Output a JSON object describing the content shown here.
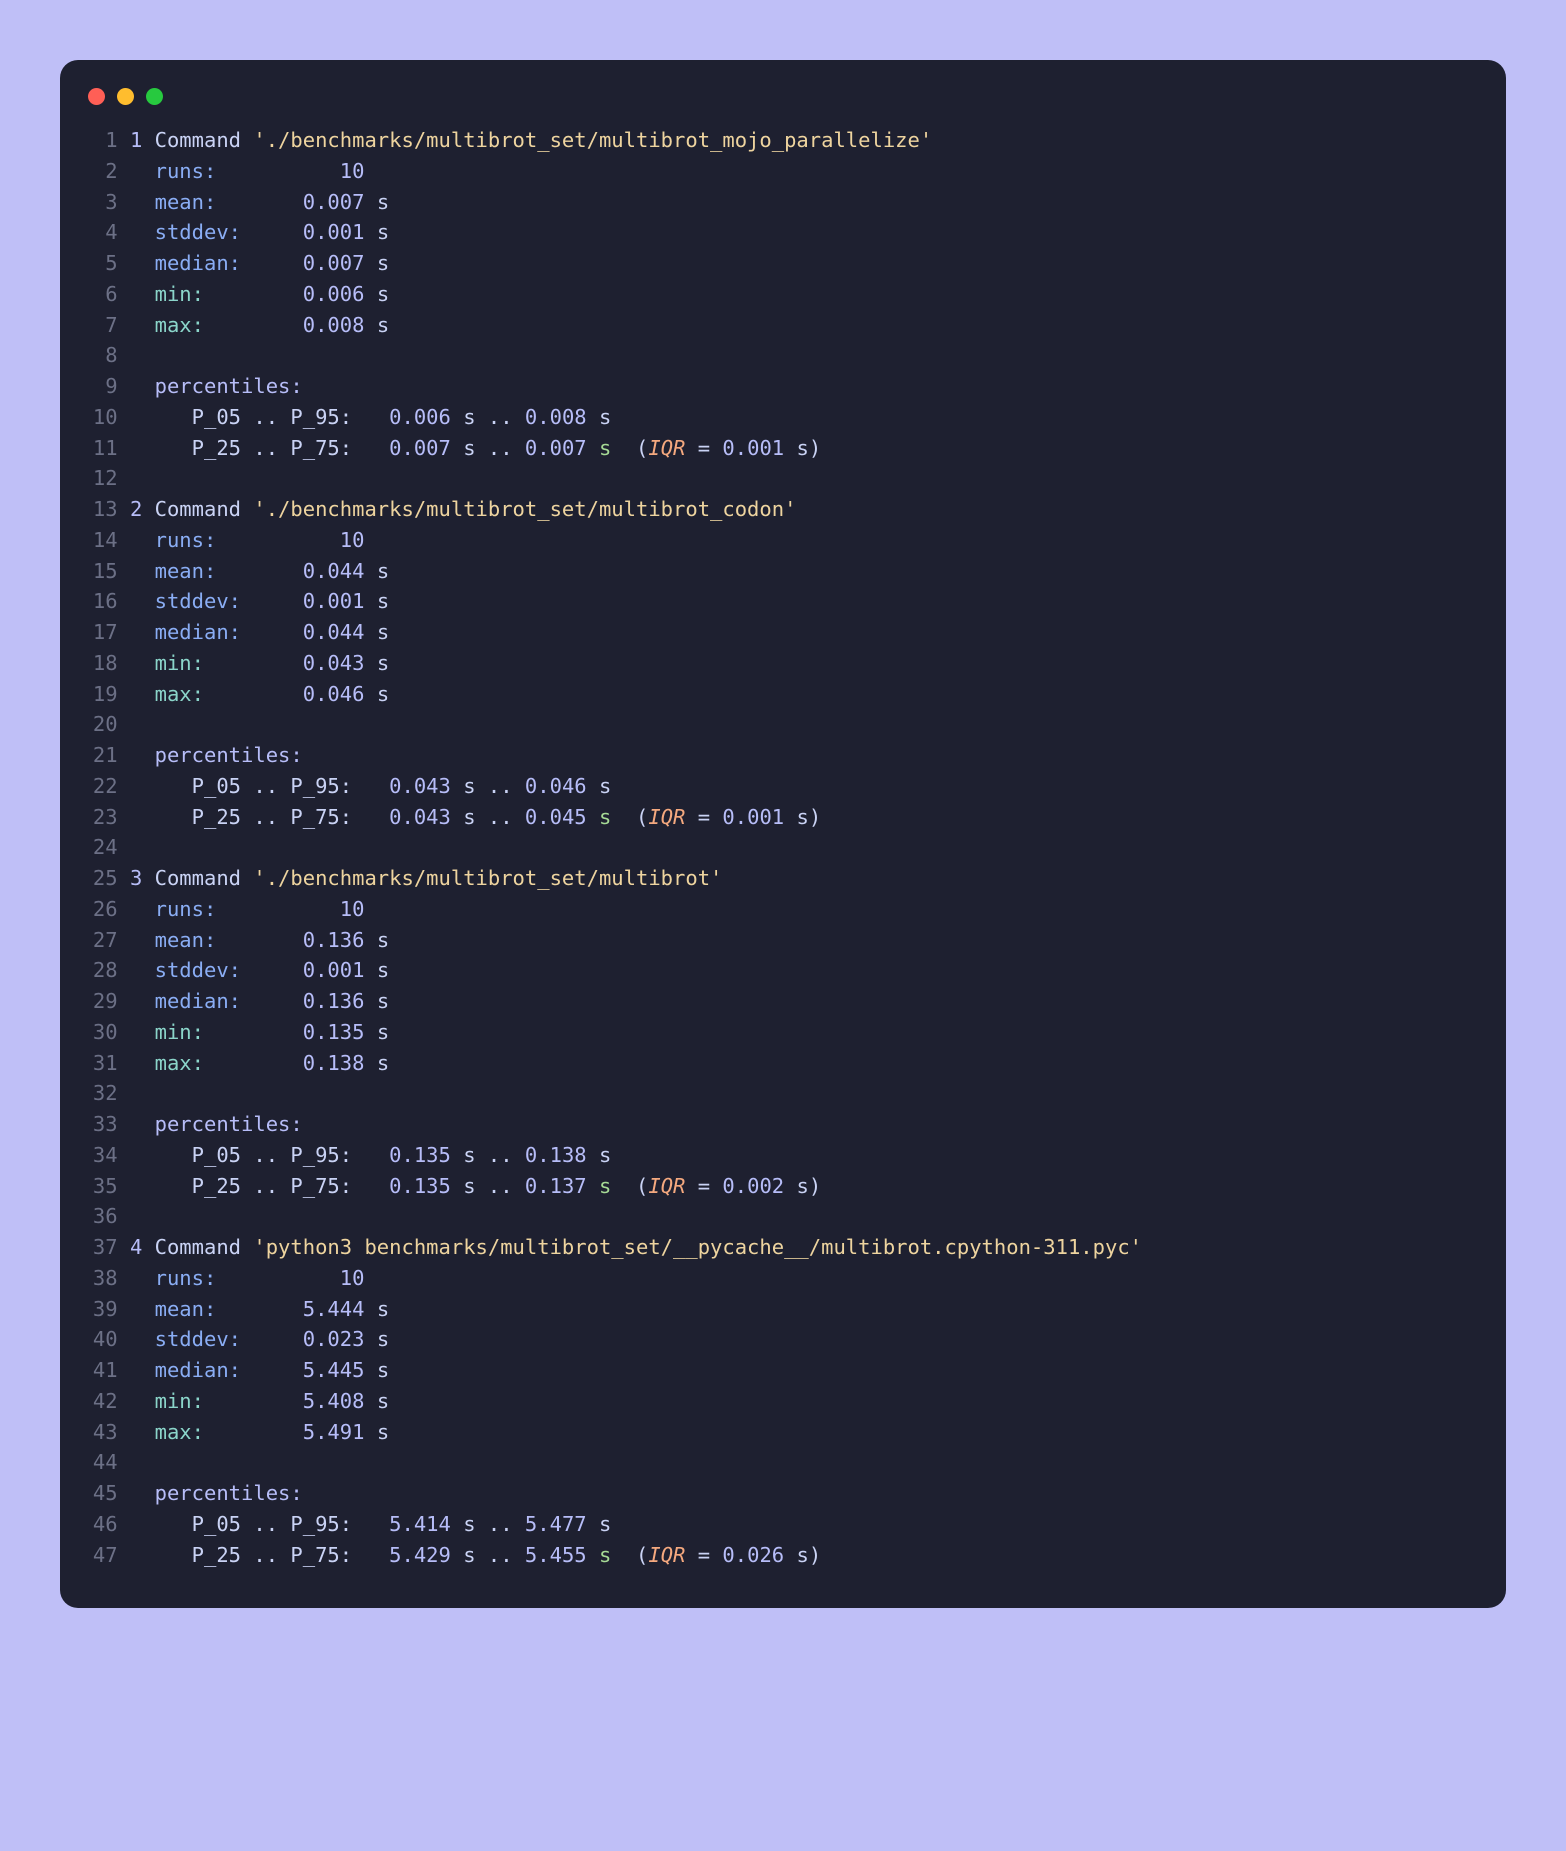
{
  "blocks": [
    {
      "idx": "1",
      "command": "'./benchmarks/multibrot_set/multibrot_mojo_parallelize'",
      "runs": "10",
      "mean": "0.007",
      "stddev": "0.001",
      "median": "0.007",
      "min": "0.006",
      "max": "0.008",
      "p05": "0.006",
      "p95": "0.008",
      "p25": "0.007",
      "p75": "0.007",
      "iqr": "0.001"
    },
    {
      "idx": "2",
      "command": "'./benchmarks/multibrot_set/multibrot_codon'",
      "runs": "10",
      "mean": "0.044",
      "stddev": "0.001",
      "median": "0.044",
      "min": "0.043",
      "max": "0.046",
      "p05": "0.043",
      "p95": "0.046",
      "p25": "0.043",
      "p75": "0.045",
      "iqr": "0.001"
    },
    {
      "idx": "3",
      "command": "'./benchmarks/multibrot_set/multibrot'",
      "runs": "10",
      "mean": "0.136",
      "stddev": "0.001",
      "median": "0.136",
      "min": "0.135",
      "max": "0.138",
      "p05": "0.135",
      "p95": "0.138",
      "p25": "0.135",
      "p75": "0.137",
      "iqr": "0.002"
    },
    {
      "idx": "4",
      "command": "'python3 benchmarks/multibrot_set/__pycache__/multibrot.cpython-311.pyc'",
      "runs": "10",
      "mean": "5.444",
      "stddev": "0.023",
      "median": "5.445",
      "min": "5.408",
      "max": "5.491",
      "p05": "5.414",
      "p95": "5.477",
      "p25": "5.429",
      "p75": "5.455",
      "iqr": "0.026"
    }
  ],
  "labels": {
    "command": "Command",
    "runs": "runs:",
    "mean": "mean:",
    "stddev": "stddev:",
    "median": "median:",
    "min": "min:",
    "max": "max:",
    "percentiles": "percentiles:",
    "p_05_95_label": "P_05 .. P_95:",
    "p_25_75_label": "P_25 .. P_75:",
    "iqr_label": "IQR",
    "sec_unit": "s",
    "sep": " .. "
  }
}
